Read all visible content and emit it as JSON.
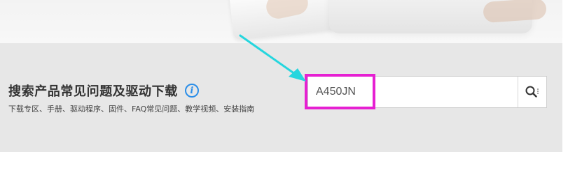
{
  "search_section": {
    "title": "搜索产品常见问题及驱动下载",
    "info_icon_glyph": "i",
    "subtitle": "下载专区、手册、驱动程序、固件、FAQ常见问题、教学视频、安装指南",
    "search_input_value": "A450JN"
  },
  "colors": {
    "band_background": "#e7e7e7",
    "highlight_border": "#e620d2",
    "arrow": "#26d6de",
    "info_icon": "#2b8ee8"
  },
  "icons": {
    "info": "info-icon",
    "search": "search-icon"
  }
}
